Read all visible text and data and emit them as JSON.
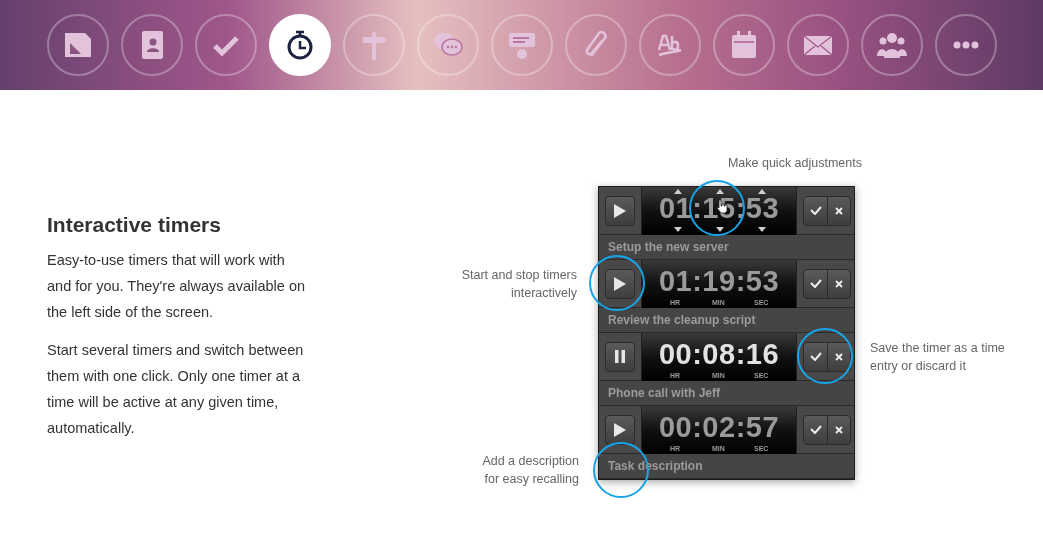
{
  "nav": {
    "items": [
      {
        "kind": "ruler",
        "selected": false
      },
      {
        "kind": "contacts",
        "selected": false
      },
      {
        "kind": "check",
        "selected": false
      },
      {
        "kind": "stopwatch",
        "selected": true
      },
      {
        "kind": "signpost",
        "selected": false
      },
      {
        "kind": "chat",
        "selected": false
      },
      {
        "kind": "feedback",
        "selected": false
      },
      {
        "kind": "paperclip",
        "selected": false
      },
      {
        "kind": "spelling",
        "selected": false
      },
      {
        "kind": "calendar",
        "selected": false
      },
      {
        "kind": "mail",
        "selected": false
      },
      {
        "kind": "people",
        "selected": false
      },
      {
        "kind": "more",
        "selected": false
      }
    ]
  },
  "feature": {
    "title": "Interactive timers",
    "paragraphs": [
      "Easy-to-use timers that will work with and for you. They're always available on the left side of the screen.",
      "Start several timers and switch between them with one click. Only one timer at a time will be active at any given time, automatically."
    ]
  },
  "timers": [
    {
      "time": [
        "01",
        "15",
        "53"
      ],
      "separators": [
        ":",
        ":"
      ],
      "adjusting": true,
      "running": false,
      "description": "Setup the new server"
    },
    {
      "time": [
        "01",
        "19",
        "53"
      ],
      "separators": [
        ":",
        ":"
      ],
      "units": [
        "HR",
        "MIN",
        "SEC"
      ],
      "adjusting": false,
      "running": false,
      "description": "Review the cleanup script"
    },
    {
      "time": [
        "00",
        "08",
        "16"
      ],
      "separators": [
        ":",
        ":"
      ],
      "units": [
        "HR",
        "MIN",
        "SEC"
      ],
      "adjusting": false,
      "running": true,
      "description": "Phone call with Jeff"
    },
    {
      "time": [
        "00",
        "02",
        "57"
      ],
      "separators": [
        ":",
        ":"
      ],
      "units": [
        "HR",
        "MIN",
        "SEC"
      ],
      "adjusting": false,
      "running": false,
      "description": "Task description"
    }
  ],
  "annotations": [
    "Make quick adjustments",
    "Start and stop timers\ninteractively",
    "Save the timer as a time\nentry or discard it",
    "Add a description\nfor easy recalling"
  ]
}
